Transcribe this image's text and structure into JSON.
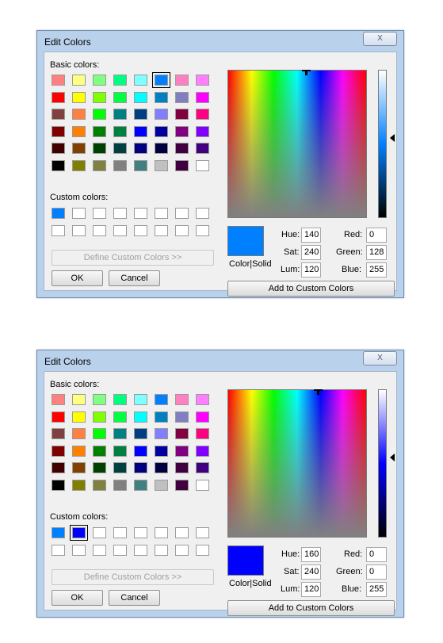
{
  "dialogs": [
    {
      "title": "Edit Colors",
      "close_glyph": "X",
      "basic_colors_label": "Basic colors:",
      "custom_colors_label": "Custom colors:",
      "define_custom_label": "Define Custom Colors >>",
      "ok_label": "OK",
      "cancel_label": "Cancel",
      "add_custom_label": "Add to Custom Colors",
      "color_solid_label": "Color|Solid",
      "hue_label": "Hue:",
      "sat_label": "Sat:",
      "lum_label": "Lum:",
      "red_label": "Red:",
      "green_label": "Green:",
      "blue_label": "Blue:",
      "hue": "140",
      "sat": "240",
      "lum": "120",
      "red": "0",
      "green": "128",
      "blue": "255",
      "preview_color": "#0080ff",
      "lum_top_color": "#ffffff",
      "lum_mid_color": "#0080ff",
      "selected_basic_index": 5,
      "selected_custom_index": -1,
      "custom_colors": [
        "#0080ff",
        "#ffffff",
        "#ffffff",
        "#ffffff",
        "#ffffff",
        "#ffffff",
        "#ffffff",
        "#ffffff",
        "#ffffff",
        "#ffffff",
        "#ffffff",
        "#ffffff",
        "#ffffff",
        "#ffffff",
        "#ffffff",
        "#ffffff"
      ]
    },
    {
      "title": "Edit Colors",
      "close_glyph": "X",
      "basic_colors_label": "Basic colors:",
      "custom_colors_label": "Custom colors:",
      "define_custom_label": "Define Custom Colors >>",
      "ok_label": "OK",
      "cancel_label": "Cancel",
      "add_custom_label": "Add to Custom Colors",
      "color_solid_label": "Color|Solid",
      "hue_label": "Hue:",
      "sat_label": "Sat:",
      "lum_label": "Lum:",
      "red_label": "Red:",
      "green_label": "Green:",
      "blue_label": "Blue:",
      "hue": "160",
      "sat": "240",
      "lum": "120",
      "red": "0",
      "green": "0",
      "blue": "255",
      "preview_color": "#0000ff",
      "lum_top_color": "#ffffff",
      "lum_mid_color": "#0000ff",
      "selected_basic_index": -1,
      "selected_custom_index": 1,
      "custom_colors": [
        "#0080ff",
        "#0000ff",
        "#ffffff",
        "#ffffff",
        "#ffffff",
        "#ffffff",
        "#ffffff",
        "#ffffff",
        "#ffffff",
        "#ffffff",
        "#ffffff",
        "#ffffff",
        "#ffffff",
        "#ffffff",
        "#ffffff",
        "#ffffff"
      ]
    }
  ],
  "basic_colors": [
    "#ff8080",
    "#ffff80",
    "#80ff80",
    "#00ff80",
    "#80ffff",
    "#0080ff",
    "#ff80c0",
    "#ff80ff",
    "#ff0000",
    "#ffff00",
    "#80ff00",
    "#00ff40",
    "#00ffff",
    "#0080c0",
    "#8080c0",
    "#ff00ff",
    "#804040",
    "#ff8040",
    "#00ff00",
    "#008080",
    "#004080",
    "#8080ff",
    "#800040",
    "#ff0080",
    "#800000",
    "#ff8000",
    "#008000",
    "#008040",
    "#0000ff",
    "#0000a0",
    "#800080",
    "#8000ff",
    "#400000",
    "#804000",
    "#004000",
    "#004040",
    "#000080",
    "#000040",
    "#400040",
    "#400080",
    "#000000",
    "#808000",
    "#808040",
    "#808080",
    "#408080",
    "#c0c0c0",
    "#400040",
    "#ffffff"
  ]
}
